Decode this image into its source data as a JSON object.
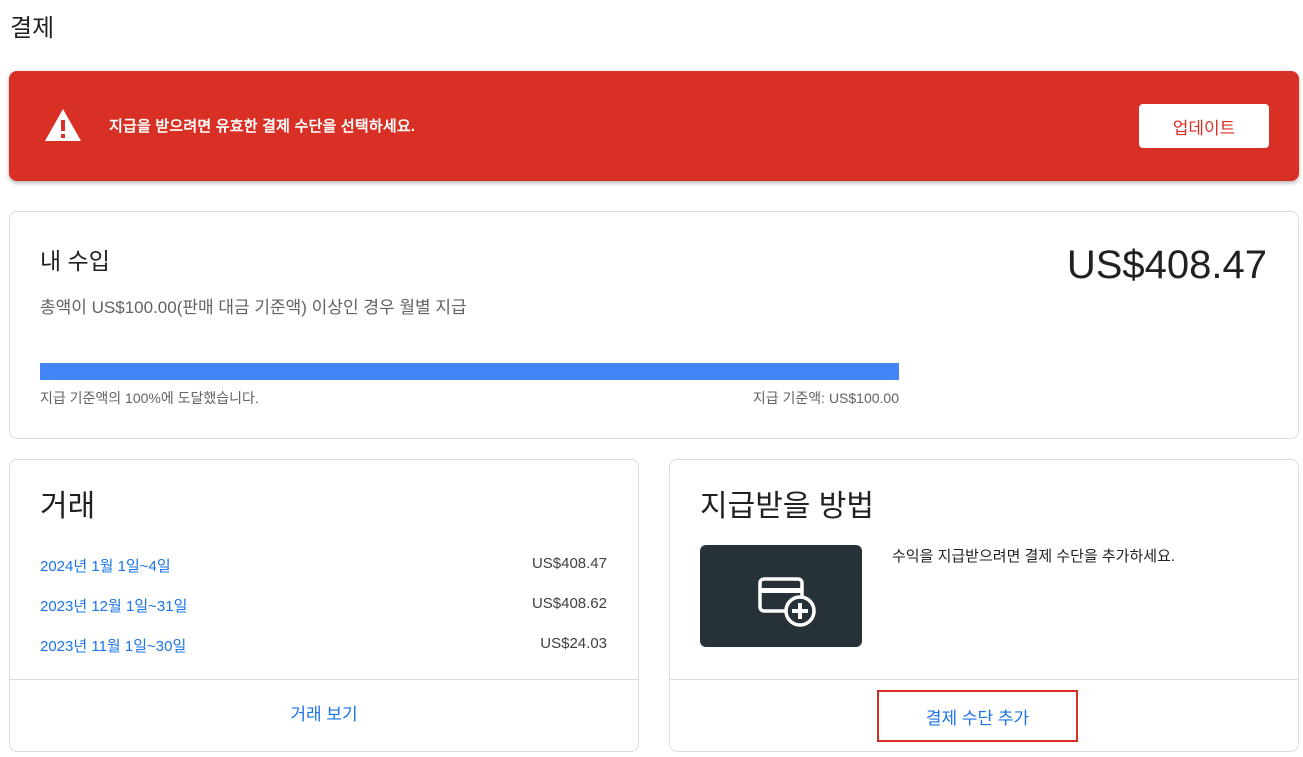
{
  "page": {
    "title": "결제"
  },
  "alert": {
    "message": "지급을 받으려면 유효한 결제 수단을 선택하세요.",
    "button_label": "업데이트",
    "icon": "warning-icon",
    "color": "#d93025"
  },
  "earnings": {
    "title": "내 수입",
    "subtitle": "총액이 US$100.00(판매 대금 기준액) 이상인 경우 월별 지급",
    "amount": "US$408.47",
    "progress_percent": 100,
    "progress_label": "지급 기준액의 100%에 도달했습니다.",
    "threshold_label": "지급 기준액: US$100.00",
    "progress_color": "#4285f4"
  },
  "transactions": {
    "title": "거래",
    "rows": [
      {
        "period": "2024년 1월 1일~4일",
        "amount": "US$408.47"
      },
      {
        "period": "2023년 12월 1일~31일",
        "amount": "US$408.62"
      },
      {
        "period": "2023년 11월 1일~30일",
        "amount": "US$24.03"
      }
    ],
    "view_label": "거래 보기"
  },
  "payout_method": {
    "title": "지급받을 방법",
    "description": "수익을 지급받으려면 결제 수단을 추가하세요.",
    "tile_icon": "add-card-icon",
    "add_label": "결제 수단 추가"
  }
}
